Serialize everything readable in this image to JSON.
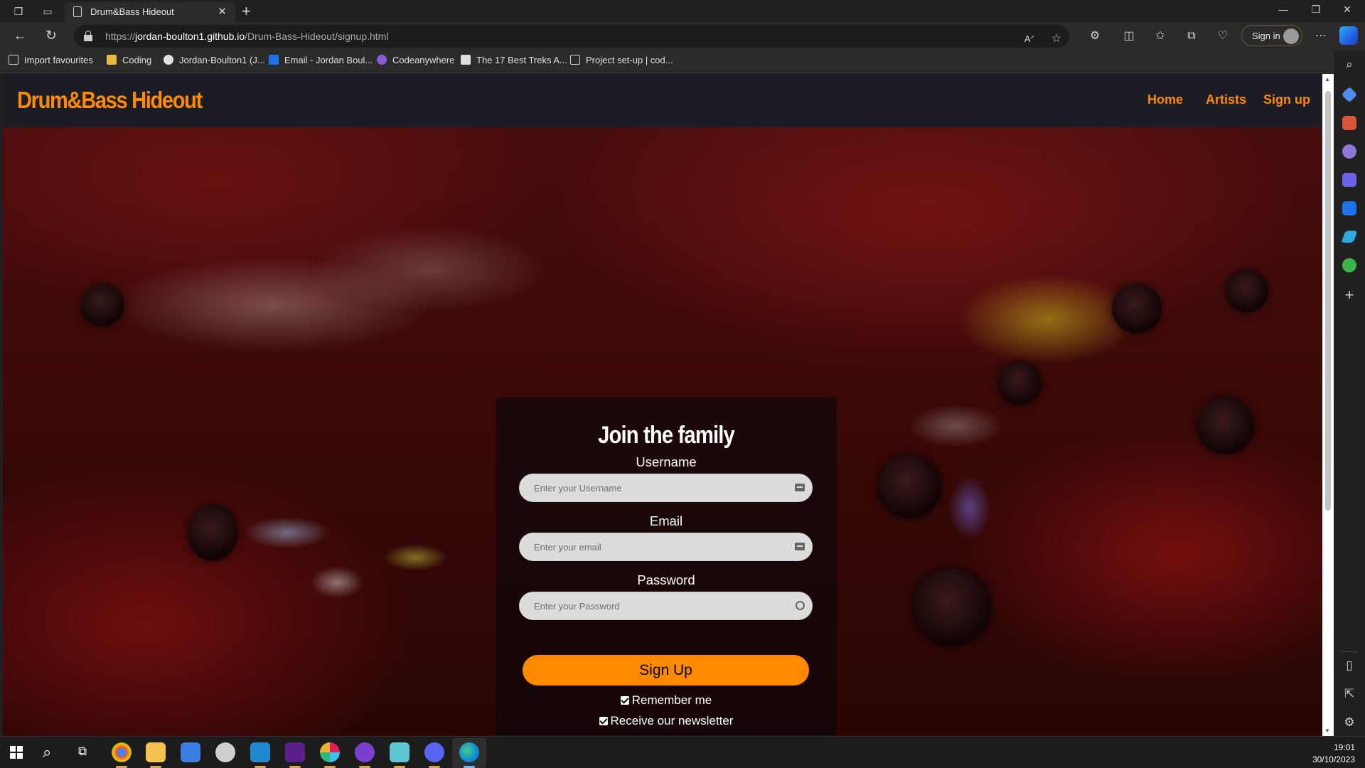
{
  "browser": {
    "tab_title": "Drum&Bass Hideout",
    "url_scheme": "https://",
    "url_host": "jordan-boulton1.github.io",
    "url_path": "/Drum-Bass-Hideout/signup.html",
    "signin_label": "Sign in"
  },
  "favourites": [
    {
      "label": "Import favourites",
      "icon": "import-icon"
    },
    {
      "label": "Coding",
      "icon": "folder-icon"
    },
    {
      "label": "Jordan-Boulton1 (J...",
      "icon": "github-icon"
    },
    {
      "label": "Email - Jordan Boul...",
      "icon": "outlook-icon"
    },
    {
      "label": "Codeanywhere",
      "icon": "codeanywhere-icon"
    },
    {
      "label": "The 17 Best Treks A...",
      "icon": "page-icon"
    },
    {
      "label": "Project set-up | cod...",
      "icon": "page-icon"
    }
  ],
  "site": {
    "logo": "Drum&Bass Hideout",
    "nav": [
      "Home",
      "Artists",
      "Sign up"
    ]
  },
  "form": {
    "title": "Join the family",
    "username_label": "Username",
    "username_placeholder": "Enter your Username",
    "email_label": "Email",
    "email_placeholder": "Enter your email",
    "password_label": "Password",
    "password_placeholder": "Enter your Password",
    "submit_label": "Sign Up",
    "remember_label": "Remember me",
    "newsletter_label": "Receive our newsletter",
    "remember_checked": true,
    "newsletter_checked": true
  },
  "taskbar": {
    "time": "19:01",
    "date": "30/10/2023"
  },
  "colors": {
    "accent": "#ff8a00",
    "header_bg": "#1c1c24",
    "card_bg": "rgba(12,8,10,0.62)"
  }
}
